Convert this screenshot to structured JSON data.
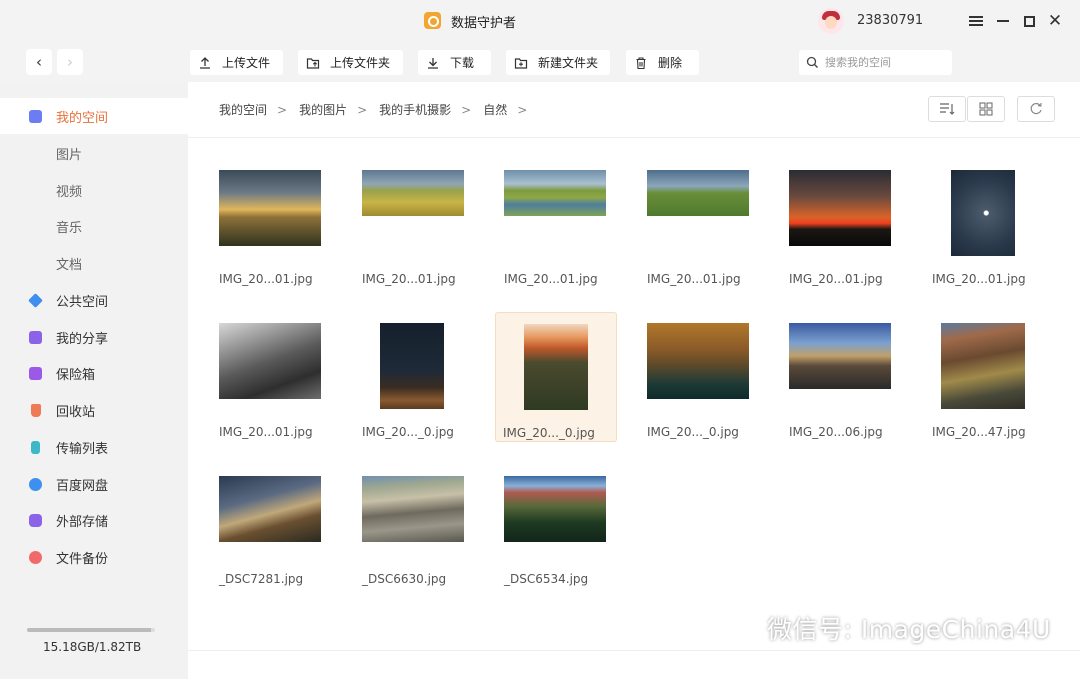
{
  "app": {
    "title": "数据守护者",
    "user_id": "23830791"
  },
  "toolbar": {
    "upload_file": "上传文件",
    "upload_folder": "上传文件夹",
    "download": "下载",
    "new_folder": "新建文件夹",
    "delete": "删除",
    "search_placeholder": "搜索我的空间"
  },
  "sidebar": {
    "items": [
      {
        "label": "我的空间",
        "icon": "my-space-icon",
        "color": "#6c7cf2"
      },
      {
        "label": "图片"
      },
      {
        "label": "视频"
      },
      {
        "label": "音乐"
      },
      {
        "label": "文档"
      },
      {
        "label": "公共空间",
        "icon": "public-space-icon",
        "color": "#3f8ef0"
      },
      {
        "label": "我的分享",
        "icon": "share-icon",
        "color": "#8a63e8"
      },
      {
        "label": "保险箱",
        "icon": "safe-icon",
        "color": "#9a59e6"
      },
      {
        "label": "回收站",
        "icon": "recycle-bin-icon",
        "color": "#f07a55"
      },
      {
        "label": "传输列表",
        "icon": "transfer-icon",
        "color": "#3cb8c8"
      },
      {
        "label": "百度网盘",
        "icon": "baidu-pan-icon",
        "color": "#3d8ff0"
      },
      {
        "label": "外部存储",
        "icon": "external-storage-icon",
        "color": "#8a63e8"
      },
      {
        "label": "文件备份",
        "icon": "backup-icon",
        "color": "#f06a6a"
      }
    ],
    "storage_text": "15.18GB/1.82TB",
    "storage_used_fraction": 0.97
  },
  "breadcrumb": [
    "我的空间",
    "我的图片",
    "我的手机摄影",
    "自然"
  ],
  "files": [
    {
      "name": "IMG_20...01.jpg"
    },
    {
      "name": "IMG_20...01.jpg"
    },
    {
      "name": "IMG_20...01.jpg"
    },
    {
      "name": "IMG_20...01.jpg"
    },
    {
      "name": "IMG_20...01.jpg"
    },
    {
      "name": "IMG_20...01.jpg"
    },
    {
      "name": "IMG_20...01.jpg"
    },
    {
      "name": "IMG_20..._0.jpg"
    },
    {
      "name": "IMG_20..._0.jpg"
    },
    {
      "name": "IMG_20..._0.jpg"
    },
    {
      "name": "IMG_20...06.jpg"
    },
    {
      "name": "IMG_20...47.jpg"
    },
    {
      "name": "_DSC7281.jpg"
    },
    {
      "name": "_DSC6630.jpg"
    },
    {
      "name": "_DSC6534.jpg"
    }
  ],
  "watermark": "微信号: ImageChina4U"
}
